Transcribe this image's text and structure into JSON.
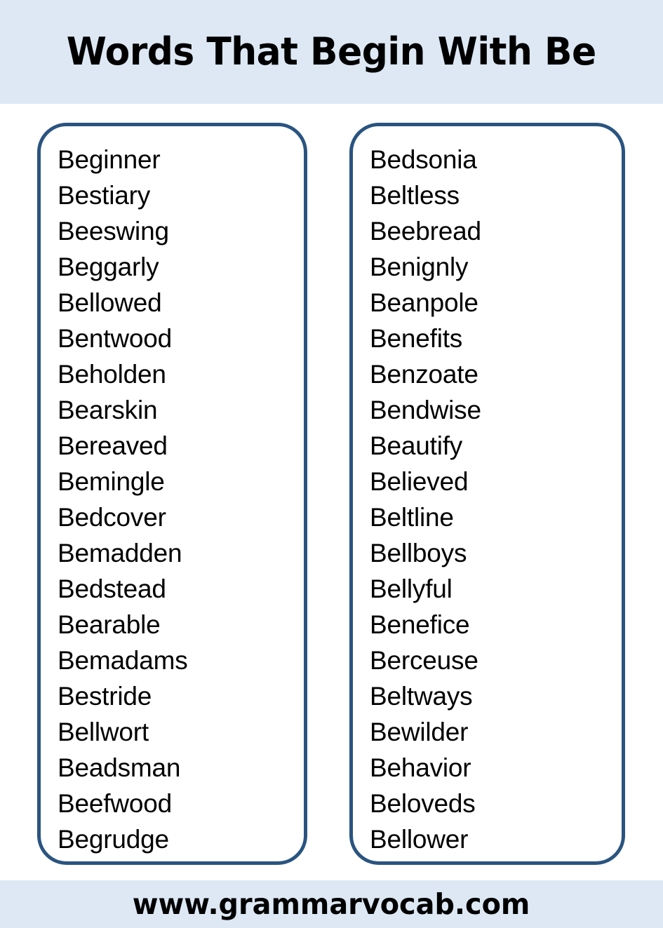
{
  "header": {
    "title": "Words That Begin With Be",
    "background_color": "#dde8f4"
  },
  "theme": {
    "band_color": "#dde8f4",
    "box_border_color": "#2a5480",
    "page_background": "#ffffff",
    "text_color": "#000000"
  },
  "columns": [
    {
      "id": "left-column",
      "words": [
        "Beginner",
        "Bestiary",
        "Beeswing",
        "Beggarly",
        "Bellowed",
        "Bentwood",
        "Beholden",
        "Bearskin",
        "Bereaved",
        "Bemingle",
        "Bedcover",
        "Bemadden",
        "Bedstead",
        "Bearable",
        "Bemadams",
        "Bestride",
        "Bellwort",
        "Beadsman",
        "Beefwood",
        "Begrudge"
      ]
    },
    {
      "id": "right-column",
      "words": [
        "Bedsonia",
        "Beltless",
        "Beebread",
        "Benignly",
        "Beanpole",
        "Benefits",
        "Benzoate",
        "Bendwise",
        "Beautify",
        "Believed",
        "Beltline",
        "Bellboys",
        "Bellyful",
        "Benefice",
        "Berceuse",
        "Beltways",
        "Bewilder",
        "Behavior",
        "Beloveds",
        "Bellower"
      ]
    }
  ],
  "footer": {
    "url": "www.grammarvocab.com",
    "background_color": "#dde8f4"
  }
}
